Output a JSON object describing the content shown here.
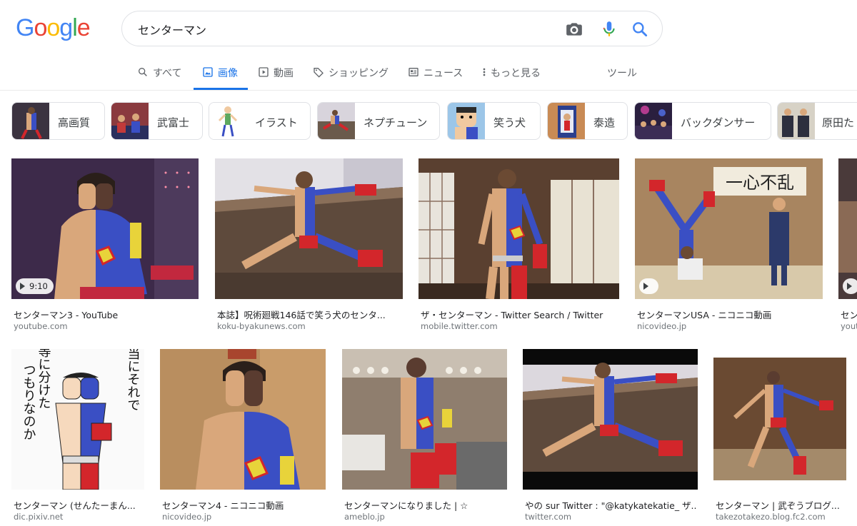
{
  "logo": {
    "text": [
      "G",
      "o",
      "o",
      "g",
      "l",
      "e"
    ],
    "colors": [
      "#4285F4",
      "#EA4335",
      "#FBBC05",
      "#4285F4",
      "#34A853",
      "#EA4335"
    ]
  },
  "search": {
    "query": "センターマン",
    "icons": [
      "camera-icon",
      "mic-icon",
      "search-icon"
    ]
  },
  "nav": {
    "items": [
      {
        "label": "すべて",
        "icon": "search-icon"
      },
      {
        "label": "画像",
        "icon": "image-icon",
        "active": true
      },
      {
        "label": "動画",
        "icon": "video-icon"
      },
      {
        "label": "ショッピング",
        "icon": "tag-icon"
      },
      {
        "label": "ニュース",
        "icon": "news-icon"
      },
      {
        "label": "もっと見る",
        "icon": "more-icon"
      }
    ],
    "tools": "ツール"
  },
  "chips": [
    "高画質",
    "武富士",
    "イラスト",
    "ネプチューン",
    "笑う犬",
    "泰造",
    "バックダンサー",
    "原田た"
  ],
  "results_row1": [
    {
      "title": "センターマン3 - YouTube",
      "source": "youtube.com",
      "duration": "9:10"
    },
    {
      "title": "本誌】呪術廻戦146話で笑う犬のセンタ...",
      "source": "koku-byakunews.com"
    },
    {
      "title": "ザ・センターマン - Twitter Search / Twitter",
      "source": "mobile.twitter.com"
    },
    {
      "title": "センターマンUSA - ニコニコ動画",
      "source": "nicovideo.jp",
      "video": true
    },
    {
      "title": "セン",
      "source": "youtube"
    }
  ],
  "results_row2": [
    {
      "title": "センターマン (せんたーまん...",
      "source": "dic.pixiv.net",
      "caption": [
        "平等に分けた",
        "つもりなのか",
        "お前ら本当にそれで"
      ]
    },
    {
      "title": "センターマン4 - ニコニコ動画",
      "source": "nicovideo.jp"
    },
    {
      "title": "センターマンになりました | ☆",
      "source": "ameblo.jp"
    },
    {
      "title": "やの sur Twitter : \"@katykatekatie_ ザ...",
      "source": "twitter.com"
    },
    {
      "title": "センターマン | 武ぞうブログ...",
      "source": "takezotakezo.blog.fc2.com"
    }
  ],
  "colors": {
    "accent": "#1a73e8",
    "costume_blue": "#3a4fc4",
    "costume_red": "#d3262b",
    "skin": "#d9a77b"
  }
}
